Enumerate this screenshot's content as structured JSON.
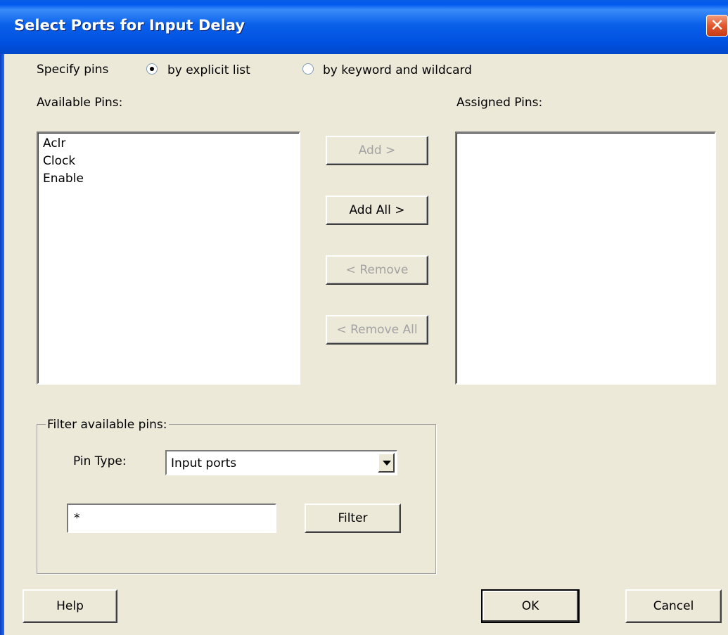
{
  "window": {
    "title": "Select Ports for Input Delay",
    "close_glyph": "✕"
  },
  "specify": {
    "label": "Specify pins",
    "options": [
      {
        "label": "by explicit list",
        "selected": true
      },
      {
        "label": "by keyword and wildcard",
        "selected": false
      }
    ]
  },
  "available": {
    "label": "Available Pins:",
    "items": [
      "Aclr",
      "Clock",
      "Enable"
    ]
  },
  "assigned": {
    "label": "Assigned Pins:",
    "items": []
  },
  "actions": {
    "add": {
      "label": "Add >",
      "enabled": false
    },
    "add_all": {
      "label": "Add All >",
      "enabled": true
    },
    "remove": {
      "label": "< Remove",
      "enabled": false
    },
    "remove_all": {
      "label": "< Remove All",
      "enabled": false
    }
  },
  "filter": {
    "group_label": "Filter available pins:",
    "pin_type_label": "Pin Type:",
    "pin_type_value": "Input ports",
    "pattern_value": "*",
    "filter_button": "Filter"
  },
  "footer": {
    "help": "Help",
    "ok": "OK",
    "cancel": "Cancel"
  },
  "colors": {
    "title_bar": "#0a61e9",
    "face": "#ece9d8",
    "close": "#e2582e"
  },
  "icons": {
    "close": "close-icon",
    "dropdown": "chevron-down-icon"
  }
}
